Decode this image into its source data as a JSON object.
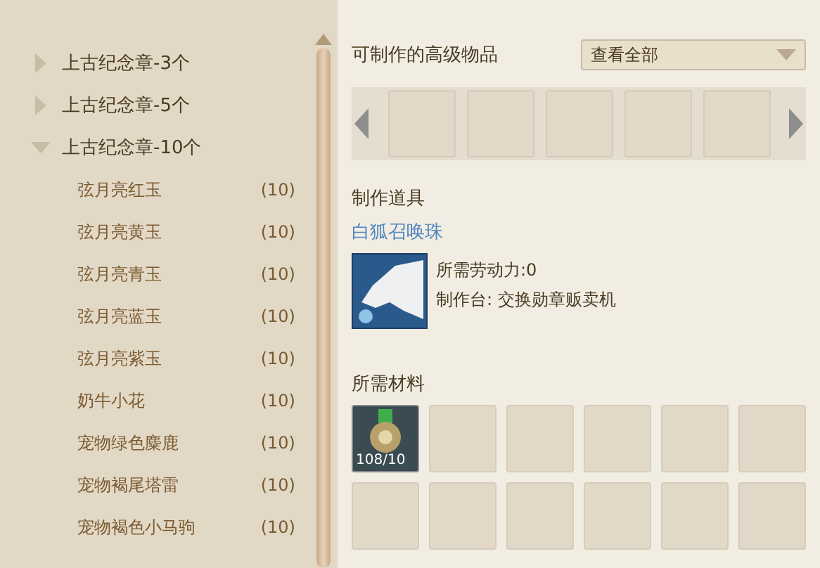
{
  "recipe_tree": [
    {
      "label": "上古纪念章-3个",
      "expanded": false
    },
    {
      "label": "上古纪念章-5个",
      "expanded": false
    },
    {
      "label": "上古纪念章-10个",
      "expanded": true,
      "children": [
        {
          "label": "弦月亮红玉",
          "count": "(10)"
        },
        {
          "label": "弦月亮黄玉",
          "count": "(10)"
        },
        {
          "label": "弦月亮青玉",
          "count": "(10)"
        },
        {
          "label": "弦月亮蓝玉",
          "count": "(10)"
        },
        {
          "label": "弦月亮紫玉",
          "count": "(10)"
        },
        {
          "label": "奶牛小花",
          "count": "(10)"
        },
        {
          "label": "宠物绿色麋鹿",
          "count": "(10)"
        },
        {
          "label": "宠物褐尾塔雷",
          "count": "(10)"
        },
        {
          "label": "宠物褐色小马驹",
          "count": "(10)"
        }
      ]
    }
  ],
  "advanced": {
    "title": "可制作的高级物品",
    "filter": "查看全部",
    "slots": [
      {
        "kind": "empty"
      },
      {
        "kind": "empty"
      },
      {
        "kind": "empty"
      },
      {
        "kind": "empty"
      },
      {
        "kind": "empty"
      }
    ]
  },
  "tool": {
    "title": "制作道具",
    "name": "白狐召唤珠",
    "labor": "所需劳动力:0",
    "station": "制作台: 交换勋章贩卖机"
  },
  "materials": {
    "title": "所需材料",
    "slots": [
      {
        "kind": "item",
        "count": "108/10"
      },
      {
        "kind": "empty"
      },
      {
        "kind": "empty"
      },
      {
        "kind": "empty"
      },
      {
        "kind": "empty"
      },
      {
        "kind": "empty"
      },
      {
        "kind": "empty"
      },
      {
        "kind": "empty"
      },
      {
        "kind": "empty"
      },
      {
        "kind": "empty"
      },
      {
        "kind": "empty"
      },
      {
        "kind": "empty"
      }
    ]
  }
}
